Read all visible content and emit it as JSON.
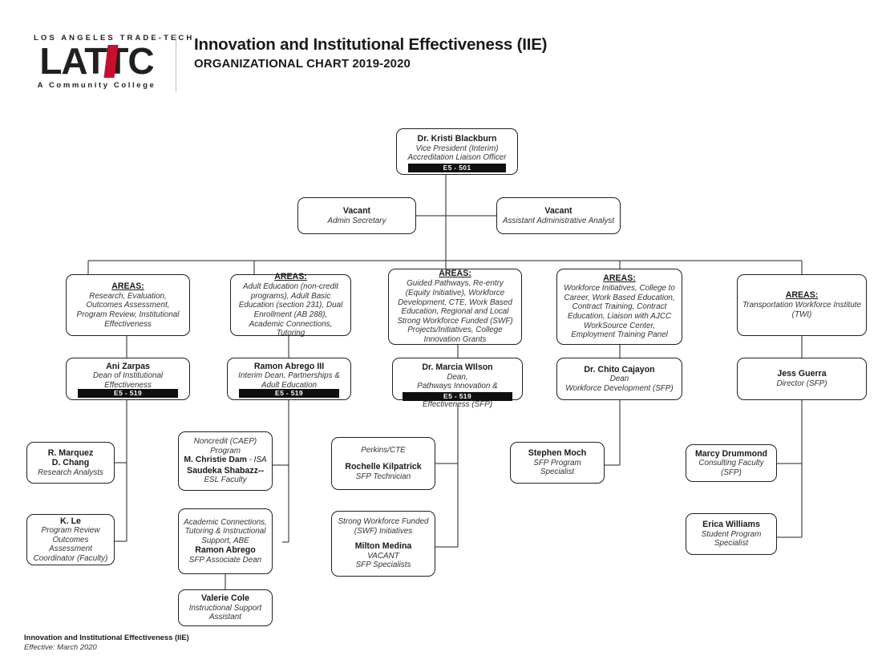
{
  "header": {
    "logo_top": "LOS ANGELES TRADE-TECH",
    "logo_word": "LATTC",
    "logo_bottom": "A Community College",
    "title_main": "Innovation and Institutional Effectiveness (IIE)",
    "title_sub": "ORGANIZATIONAL CHART 2019-2020"
  },
  "footer": {
    "line1": "Innovation and Institutional Effectiveness (IIE)",
    "line2": "Effective: March 2020"
  },
  "colors": {
    "brand_red": "#c8102e",
    "ink": "#231f20",
    "code_bar_bg": "#0f0f0f"
  },
  "nodes": {
    "vp": {
      "name": "Dr. Kristi Blackburn",
      "title1": "Vice President (Interim)",
      "title2": "Accreditation Liaison Officer",
      "code": "E5 - 501"
    },
    "admin_secretary": {
      "name": "Vacant",
      "title1": "Admin Secretary"
    },
    "admin_analyst": {
      "name": "Vacant",
      "title1": "Assistant Administrative Analyst"
    },
    "areas_1": {
      "heading": "AREAS:",
      "body": "Research, Evaluation, Outcomes Assessment, Program Review, Institutional Effectiveness"
    },
    "areas_2": {
      "heading": "AREAS:",
      "body": "Adult Education (non-credit programs), Adult Basic Education (section 231), Dual Enrollment (AB 288), Academic Connections, Tutoring"
    },
    "areas_3": {
      "heading": "AREAS:",
      "body": "Guided Pathways, Re-entry (Equity Initiative), Workforce Development, CTE, Work Based Education, Regional and Local Strong Workforce Funded (SWF) Projects/Initiatives, College Innovation Grants"
    },
    "areas_4": {
      "heading": "AREAS:",
      "body": "Workforce Initiatives, College to Career, Work Based Education, Contract Training, Contract Education, Liaison with AJCC WorkSource Center, Employment Training Panel"
    },
    "areas_5": {
      "heading": "AREAS:",
      "body": "Transportation Workforce Institute (TWI)"
    },
    "zarpas": {
      "name": "Ani Zarpas",
      "title1": "Dean of Institutional",
      "title2": "Effectiveness",
      "code": "E5 - 519"
    },
    "abrego3": {
      "name": "Ramon Abrego III",
      "title1": "Interim Dean, Partnerships &",
      "title2": "Adult Education",
      "code": "E5 - 519"
    },
    "wilson": {
      "name": "Dr. Marcia WIlson",
      "title1": "Dean,",
      "title2": "Pathways Innovation & Institutional",
      "title3": "Effectiveness (SFP)",
      "code": "E5 - 519"
    },
    "cajayon": {
      "name": "Dr. Chito Cajayon",
      "title1": "Dean",
      "title2": "Workforce Development (SFP)"
    },
    "guerra": {
      "name": "Jess Guerra",
      "title1": "Director (SFP)"
    },
    "marquez_chang": {
      "name1": "R. Marquez",
      "name2": "D. Chang",
      "title1": "Research Analysts"
    },
    "kle": {
      "name": "K. Le",
      "title1": "Program Review",
      "title2": "Outcomes Assessment",
      "title3": "Coordinator (Faculty)"
    },
    "noncredit": {
      "pre1": "Noncredit (CAEP)",
      "pre2": "Program",
      "name1": "M. Christie Dam",
      "name1_suffix": " - ISA",
      "name2": "Saudeka Shabazz--",
      "title1": "ESL Faculty"
    },
    "academic_connections": {
      "pre1": "Academic Connections,",
      "pre2": "Tutoring & Instructional",
      "pre3": "Support, ABE",
      "name": "Ramon Abrego",
      "title1": "SFP Associate Dean"
    },
    "cole": {
      "name": "Valerie Cole",
      "title1": "Instructional Support",
      "title2": "Assistant"
    },
    "kilpatrick": {
      "pre1": "Perkins/CTE",
      "name": "Rochelle Kilpatrick",
      "title1": "SFP Technician"
    },
    "medina": {
      "pre1": "Strong Workforce Funded",
      "pre2": "(SWF) Initiatives",
      "name": "Milton Medina",
      "title1": "VACANT",
      "title2": "SFP Specialists"
    },
    "moch": {
      "name": "Stephen Moch",
      "title1": "SFP Program",
      "title2": "Specialist"
    },
    "drummond": {
      "name": "Marcy Drummond",
      "title1": "Consulting Faculty (SFP)"
    },
    "ewilliams": {
      "name": "Erica Williams",
      "title1": "Student Program",
      "title2": "Specialist"
    }
  }
}
